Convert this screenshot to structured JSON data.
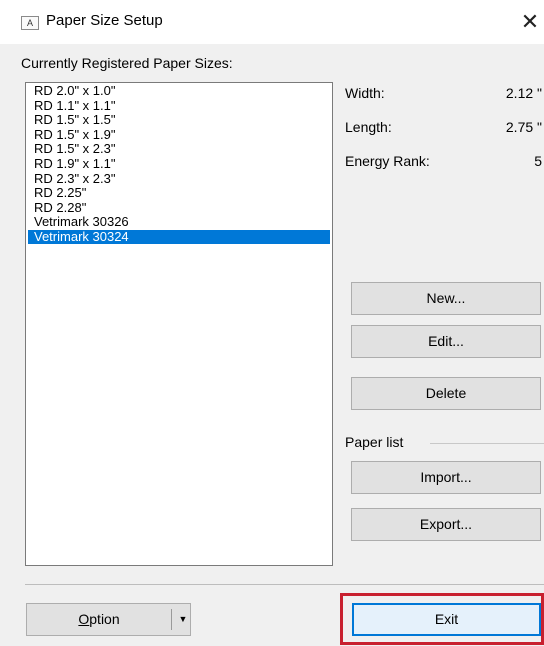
{
  "window": {
    "title": "Paper Size Setup",
    "icon": "printer-dialog-icon",
    "icon_glyph": "A",
    "close_glyph": "✕"
  },
  "list": {
    "heading": "Currently Registered Paper Sizes:",
    "items": [
      "RD 2.0\" x 1.0\"",
      "RD 1.1\" x 1.1\"",
      "RD 1.5\" x 1.5\"",
      "RD 1.5\" x 1.9\"",
      "RD 1.5\" x 2.3\"",
      "RD 1.9\" x 1.1\"",
      "RD 2.3\" x 2.3\"",
      "RD 2.25\"",
      "RD 2.28\"",
      "Vetrimark 30326",
      "Vetrimark 30324"
    ],
    "selected_index": 10
  },
  "details": {
    "width_label": "Width:",
    "width_value": "2.12 \"",
    "length_label": "Length:",
    "length_value": "2.75 \"",
    "energy_label": "Energy Rank:",
    "energy_value": "5"
  },
  "buttons": {
    "new": "New...",
    "edit": "Edit...",
    "delete": "Delete",
    "paper_list_label": "Paper list",
    "import": "Import...",
    "export": "Export...",
    "option": "Option",
    "option_mnemonic": "O",
    "option_rest": "ption",
    "option_arrow": "▼",
    "exit": "Exit"
  },
  "colors": {
    "selection": "#0078d7",
    "highlight_border": "#c8202f",
    "dialog_bg": "#f0f0f0"
  }
}
